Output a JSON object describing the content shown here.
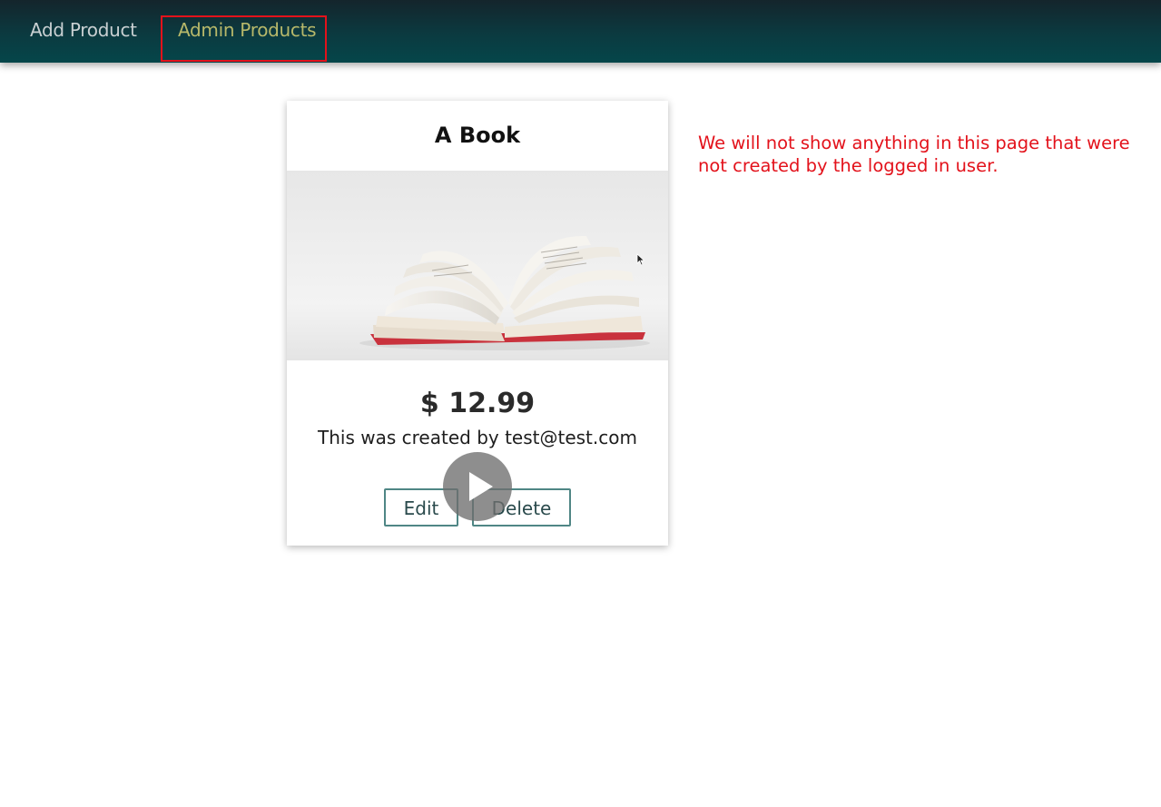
{
  "navbar": {
    "items": [
      {
        "label": "Add Product"
      },
      {
        "label": "Admin Products",
        "active": true
      }
    ]
  },
  "product": {
    "title": "A Book",
    "image_icon": "open-book-photo",
    "price": "$ 12.99",
    "description": "This was created by test@test.com",
    "edit_label": "Edit",
    "delete_label": "Delete"
  },
  "overlay": {
    "play_icon": "play-icon"
  },
  "annotation": {
    "line1": "We will not show anything in this page that were",
    "line2": "not created by the logged in user."
  },
  "colors": {
    "nav_bg": "#0b3a40",
    "nav_active": "#b7b86a",
    "nav_inactive": "#c9d0d2",
    "annotation": "#e3121b",
    "button_border": "#4f8685"
  }
}
